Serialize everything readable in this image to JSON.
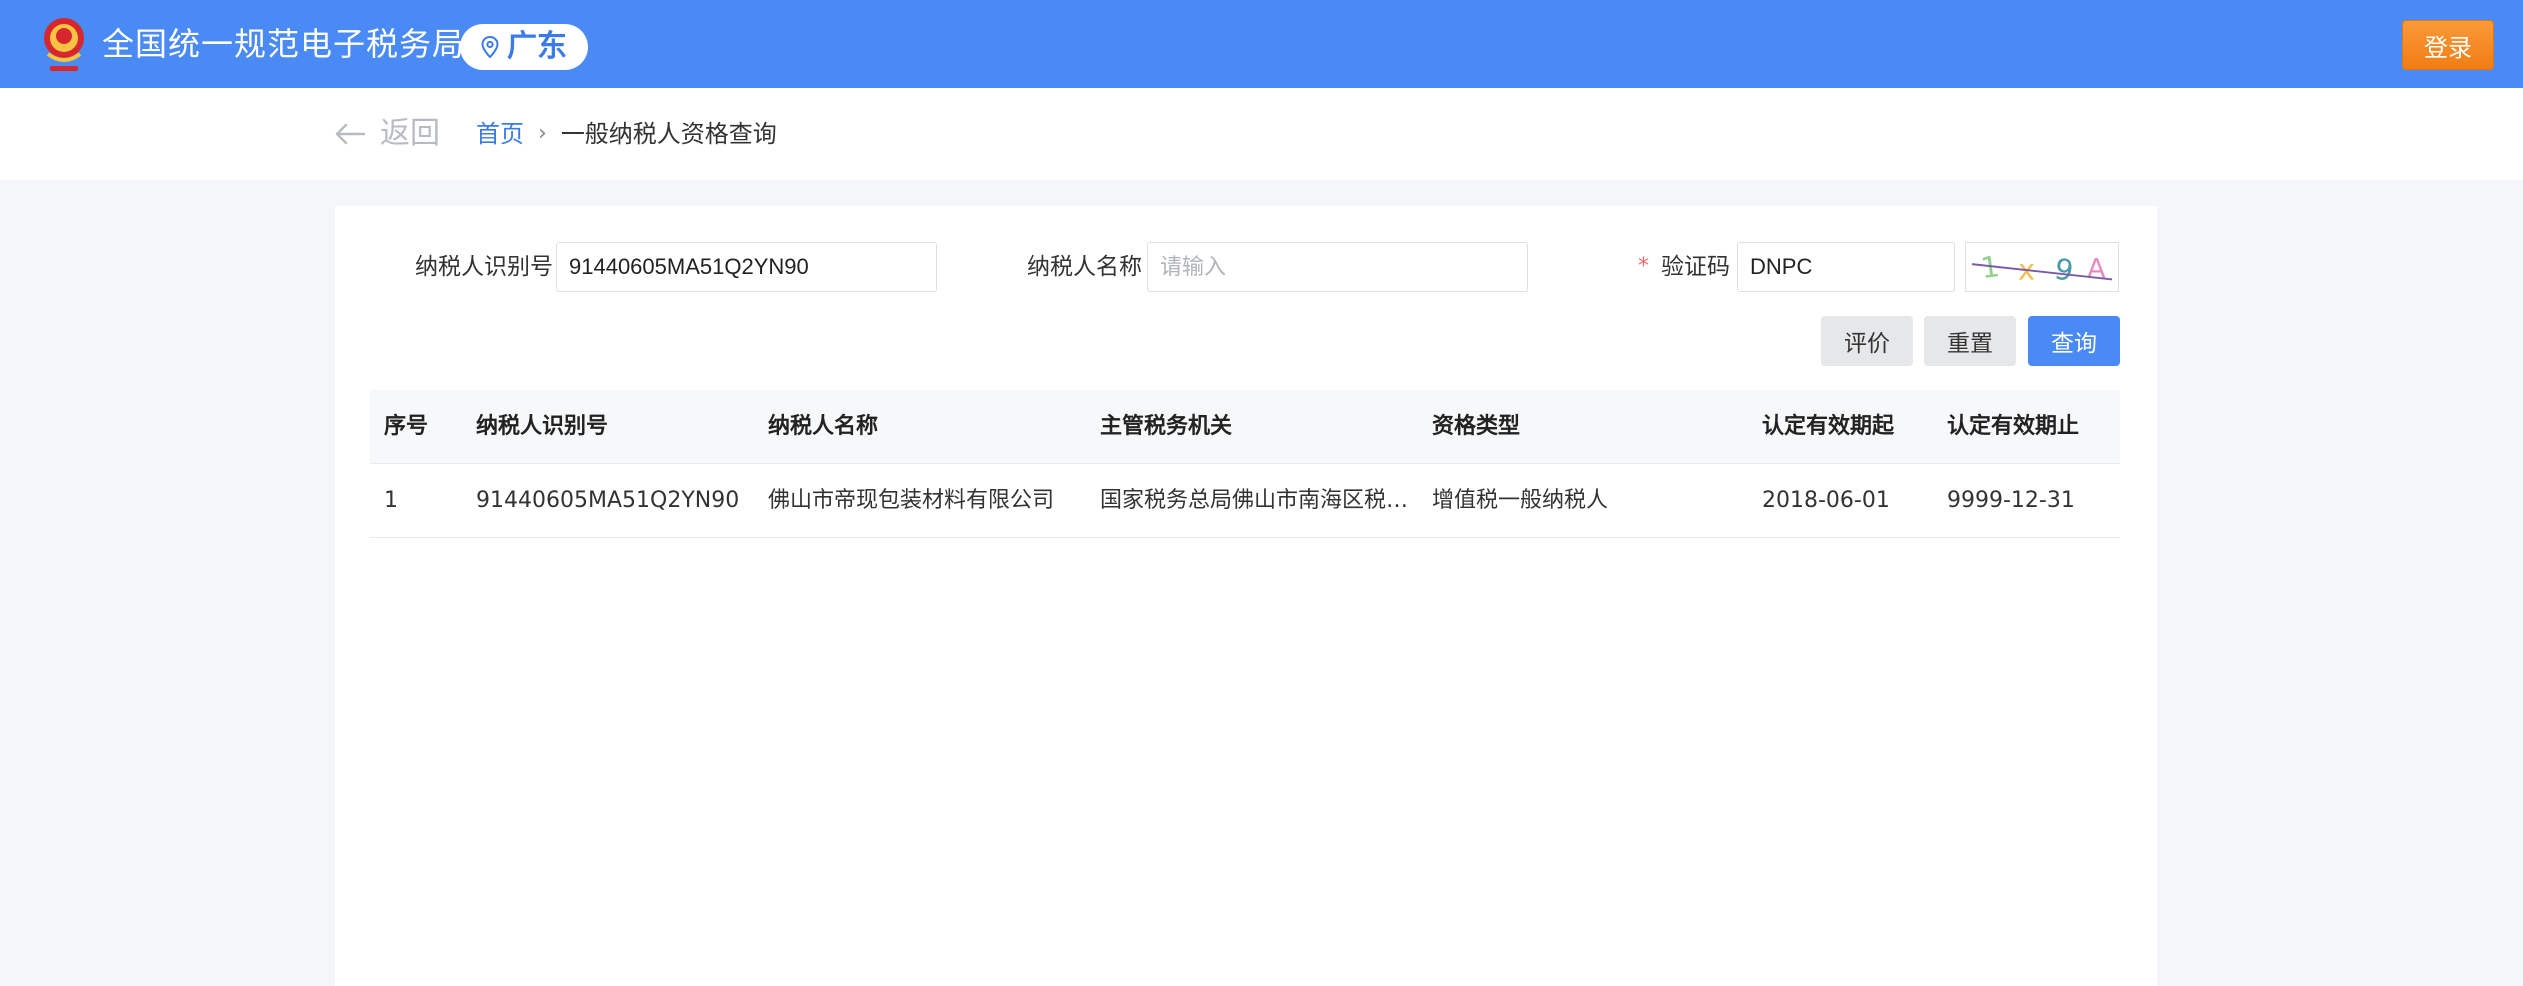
{
  "header": {
    "site_title": "全国统一规范电子税务局",
    "region_name": "广东",
    "login_label": "登录"
  },
  "breadcrumb": {
    "back_label": "返回",
    "home": "首页",
    "current": "一般纳税人资格查询"
  },
  "form": {
    "taxpayer_id_label": "纳税人识别号",
    "taxpayer_id_value": "91440605MA51Q2YN90",
    "taxpayer_name_label": "纳税人名称",
    "taxpayer_name_placeholder": "请输入",
    "required_mark": "*",
    "captcha_label": "验证码",
    "captcha_value": "DNPC"
  },
  "actions": {
    "evaluate": "评价",
    "reset": "重置",
    "query": "查询"
  },
  "table": {
    "headers": [
      "序号",
      "纳税人识别号",
      "纳税人名称",
      "主管税务机关",
      "资格类型",
      "认定有效期起",
      "认定有效期止"
    ],
    "rows": [
      [
        "1",
        "91440605MA51Q2YN90",
        "佛山市帝现包装材料有限公司",
        "国家税务总局佛山市南海区税…",
        "增值税一般纳税人",
        "2018-06-01",
        "9999-12-31"
      ]
    ]
  },
  "colors": {
    "header_bg": "#4a8af4",
    "login_btn": "#f08519",
    "primary": "#4a8af4",
    "link": "#3a7be8"
  }
}
